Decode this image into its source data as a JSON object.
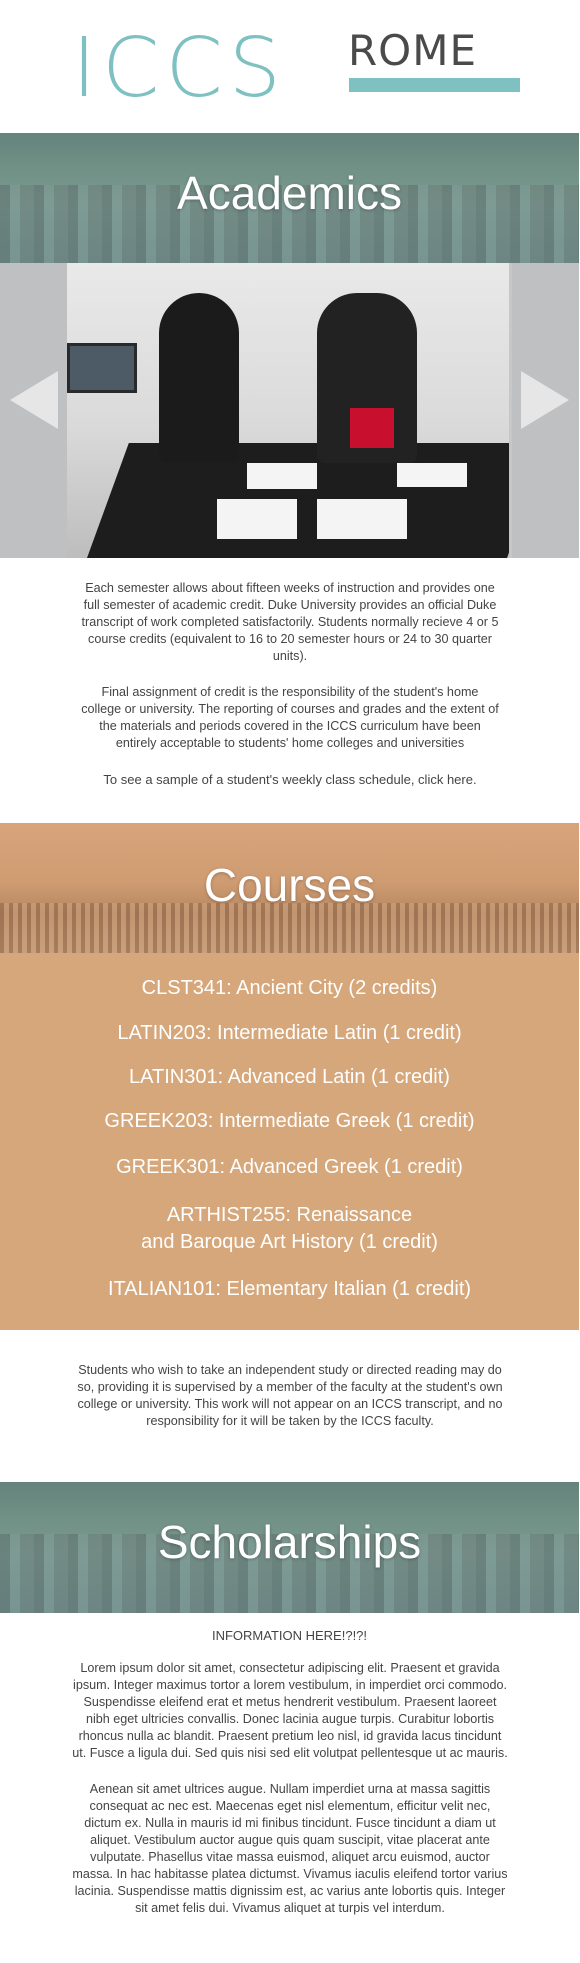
{
  "logo": {
    "iccs": "ICCS",
    "rome": "ROME"
  },
  "sections": {
    "academics_title": "Academics",
    "courses_title": "Courses",
    "scholarships_title": "Scholarships"
  },
  "academics": {
    "p1": "Each semester allows about fifteen weeks of instruction and provides one full semester of academic credit. Duke University provides an official Duke transcript of work completed satisfactorily. Students normally recieve 4 or 5 course credits (equivalent to 16 to 20 semester hours or 24 to 30 quarter units).",
    "p2": "Final assignment of credit is the responsibility of the student's home college or university. The reporting of courses and grades and the extent of the materials and periods covered in the ICCS curriculum have been entirely acceptable to students' home colleges and universities",
    "p3": "To see a sample of a student's weekly class schedule, click here."
  },
  "courses": [
    "CLST341: Ancient City (2 credits)",
    "LATIN203: Intermediate Latin (1 credit)",
    "LATIN301: Advanced Latin (1 credit)",
    "GREEK203: Intermediate Greek (1 credit)",
    "GREEK301: Advanced Greek (1 credit)",
    "ARTHIST255: Renaissance",
    "and Baroque Art History (1 credit)",
    "ITALIAN101: Elementary Italian (1 credit)"
  ],
  "independent_study": "Students who wish to take an independent study or directed reading may do so, providing it is supervised by a member of the faculty at the student's own college or university. This work will not appear on an ICCS transcript, and no responsibility for it will be taken by the ICCS faculty.",
  "scholarships": {
    "info_title": "INFORMATION HERE!?!?!",
    "p1": "Lorem ipsum dolor sit amet, consectetur adipiscing elit. Praesent et gravida ipsum. Integer maximus tortor a lorem vestibulum, in imperdiet orci commodo. Suspendisse eleifend erat et metus hendrerit vestibulum. Praesent laoreet nibh eget ultricies convallis. Donec lacinia augue turpis. Curabitur lobortis rhoncus nulla ac blandit. Praesent pretium leo nisl, id gravida lacus tincidunt ut. Fusce a ligula dui. Sed quis nisi sed elit volutpat pellentesque ut ac mauris.",
    "p2": "Aenean sit amet ultrices augue. Nullam imperdiet urna at massa sagittis consequat ac nec est. Maecenas eget nisl elementum, efficitur velit nec, dictum ex. Nulla in mauris id mi finibus tincidunt. Fusce tincidunt a diam ut aliquet. Vestibulum auctor augue quis quam suscipit, vitae placerat ante vulputate. Phasellus vitae massa euismod, aliquet arcu euismod, auctor massa. In hac habitasse platea dictumst. Vivamus iaculis eleifend tortor varius lacinia. Suspendisse mattis dignissim est, ac varius ante lobortis quis. Integer sit amet felis dui. Vivamus aliquet at turpis vel interdum."
  },
  "colors": {
    "teal": "#7fc0c0",
    "sand": "#d6a77a",
    "text": "#444444"
  }
}
